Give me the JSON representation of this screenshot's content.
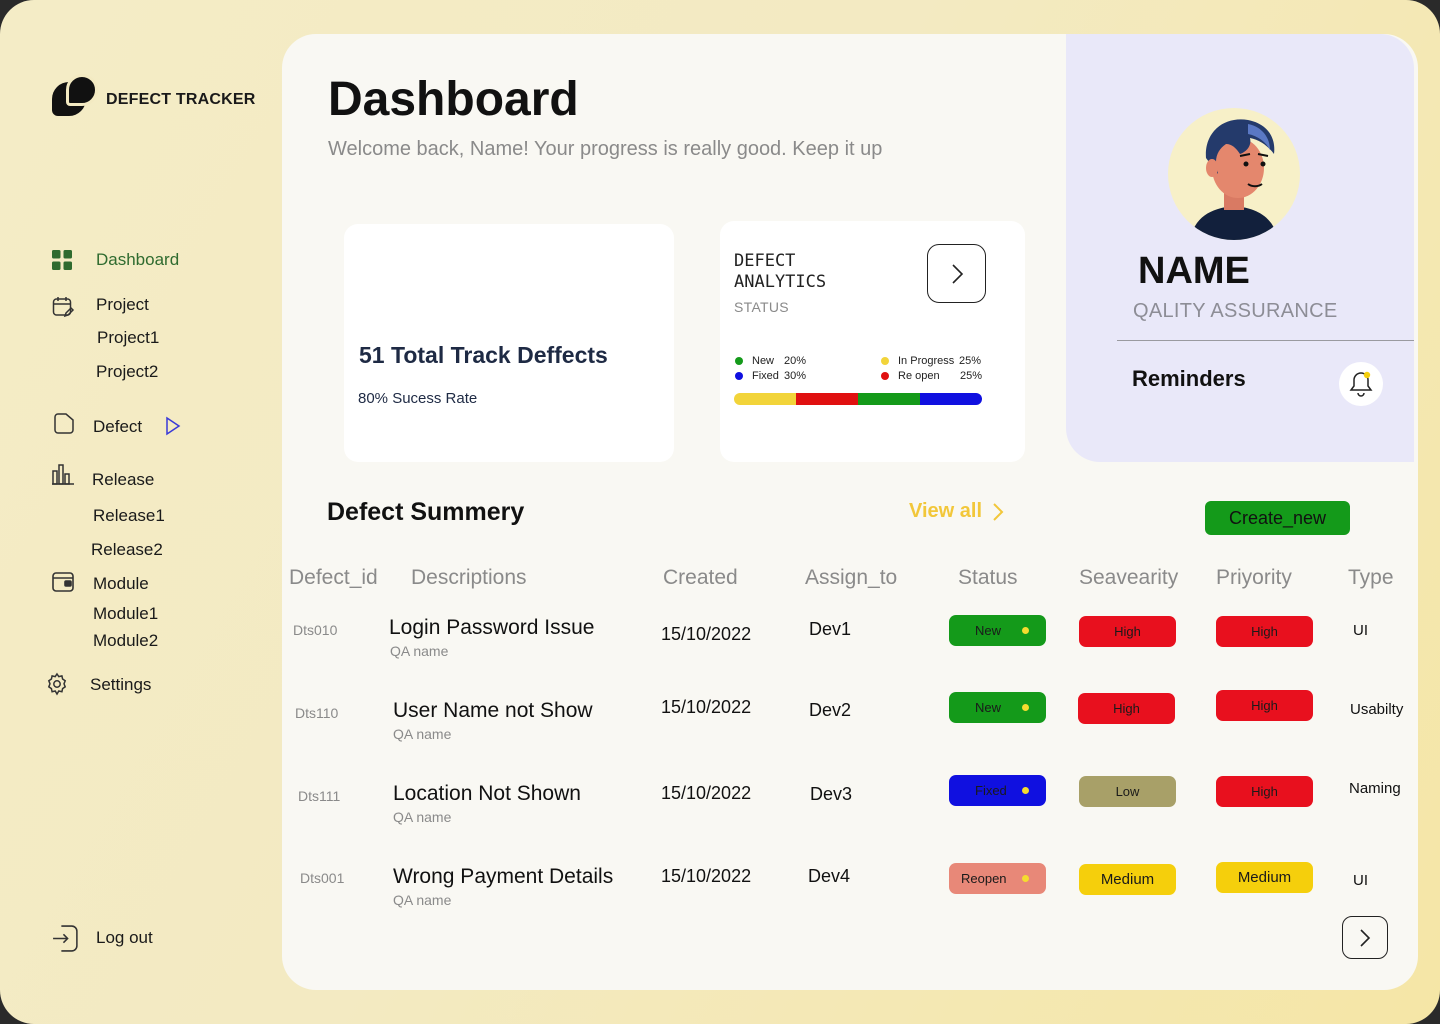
{
  "brand": {
    "name": "DEFECT TRACKER"
  },
  "sidebar": {
    "dashboard": "Dashboard",
    "project": "Project",
    "project1": "Project1",
    "project2": "Project2",
    "defect": "Defect",
    "release": "Release",
    "release1": "Release1",
    "release2": "Release2",
    "module": "Module",
    "module1": "Module1",
    "module2": "Module2",
    "settings": "Settings",
    "logout": "Log out"
  },
  "header": {
    "title": "Dashboard",
    "subtitle": "Welcome back, Name! Your progress is really good. Keep it up"
  },
  "total_card": {
    "headline": "51 Total Track Deffects",
    "rate": "80% Sucess Rate"
  },
  "analytics": {
    "title": "DEFECT ANALYTICS",
    "status_label": "STATUS",
    "legend": [
      {
        "label": "New",
        "pct": "20%",
        "color": "#149a1a"
      },
      {
        "label": "Fixed",
        "pct": "30%",
        "color": "#1010e0"
      },
      {
        "label": "In Progress",
        "pct": "25%",
        "color": "#f2d43a"
      },
      {
        "label": "Re open",
        "pct": "25%",
        "color": "#e01010"
      }
    ],
    "bar": [
      {
        "label": "In Progress",
        "fraction": 0.25,
        "color": "#f2d43a"
      },
      {
        "label": "Re open",
        "fraction": 0.25,
        "color": "#e01010"
      },
      {
        "label": "New",
        "fraction": 0.25,
        "color": "#149a1a"
      },
      {
        "label": "Fixed",
        "fraction": 0.25,
        "color": "#1010e0"
      }
    ]
  },
  "profile": {
    "name": "NAME",
    "role": "QALITY ASSURANCE",
    "reminders": "Reminders"
  },
  "summary": {
    "title": "Defect Summery",
    "view_all": "View all",
    "create_new": "Create_new",
    "columns": [
      "Defect_id",
      "Descriptions",
      "Created",
      "Assign_to",
      "Status",
      "Seavearity",
      "Priyority",
      "Type"
    ],
    "rows": [
      {
        "id": "Dts010",
        "desc": "Login Password Issue",
        "sub": "QA name",
        "created": "15/10/2022",
        "assign": "Dev1",
        "status": "New",
        "status_color": "#149a1a",
        "severity": "High",
        "severity_color": "#e8101e",
        "priority": "High",
        "priority_color": "#e8101e",
        "type": "UI"
      },
      {
        "id": "Dts110",
        "desc": "User Name not Show",
        "sub": "QA name",
        "created": "15/10/2022",
        "assign": "Dev2",
        "status": "New",
        "status_color": "#149a1a",
        "severity": "High",
        "severity_color": "#e8101e",
        "priority": "High",
        "priority_color": "#e8101e",
        "type": "Usabilty"
      },
      {
        "id": "Dts111",
        "desc": "Location Not Shown",
        "sub": "QA name",
        "created": "15/10/2022",
        "assign": "Dev3",
        "status": "Fixed",
        "status_color": "#1010e0",
        "severity": "Low",
        "severity_color": "#a8a068",
        "priority": "High",
        "priority_color": "#e8101e",
        "type": "Naming"
      },
      {
        "id": "Dts001",
        "desc": "Wrong Payment Details",
        "sub": "QA name",
        "created": "15/10/2022",
        "assign": "Dev4",
        "status": "Reopen",
        "status_color": "#e88878",
        "severity": "Medium",
        "severity_color": "#f5cf0c",
        "priority": "Medium",
        "priority_color": "#f5cf0c",
        "type": "UI"
      }
    ]
  },
  "colors": {
    "accent_green": "#149a1a",
    "warning_yellow": "#f2c73a",
    "panel_lavender": "#e9e8f9"
  },
  "icons": [
    "grid-icon",
    "calendar-edit-icon",
    "folder-icon",
    "play-outline-icon",
    "bar-chart-icon",
    "wallet-icon",
    "gear-icon",
    "logout-icon",
    "chevron-right-icon",
    "bell-icon"
  ]
}
